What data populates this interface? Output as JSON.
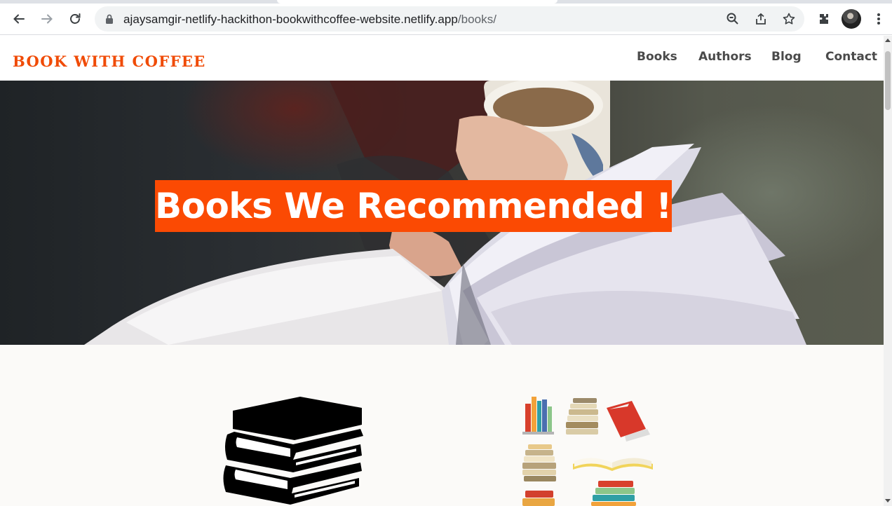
{
  "browser": {
    "url_domain": "ajaysamgir-netlify-hackithon-bookwithcoffee-website.netlify.app",
    "url_path": "/books/",
    "icons": [
      "back-arrow-icon",
      "forward-arrow-icon",
      "reload-icon",
      "lock-icon",
      "zoom-icon",
      "share-icon",
      "star-icon",
      "extensions-icon",
      "avatar",
      "menu-icon"
    ]
  },
  "site": {
    "logo": "BOOK WITH COFFEE",
    "nav": {
      "books": "Books",
      "authors": "Authors",
      "blog": "Blog",
      "contact": "Contact"
    },
    "hero": {
      "title": "Books We Recommended !"
    }
  },
  "colors": {
    "accent": "#f04b06",
    "hero_title_bg": "#fb4a03"
  }
}
